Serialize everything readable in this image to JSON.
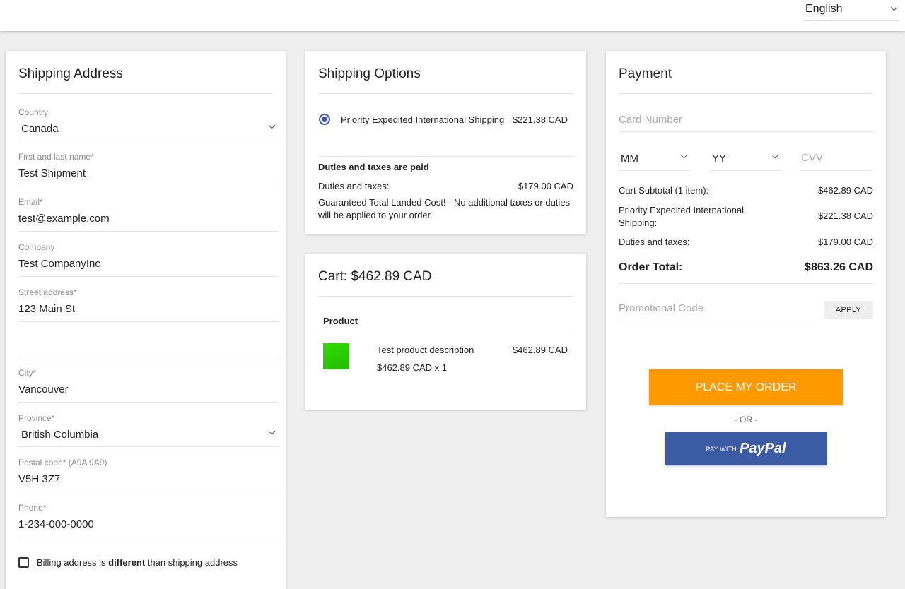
{
  "header": {
    "language": "English"
  },
  "shipping_address": {
    "title": "Shipping Address",
    "fields": [
      {
        "label": "Country",
        "value": "Canada"
      },
      {
        "label": "First and last name*",
        "value": "Test Shipment"
      },
      {
        "label": "Email*",
        "value": "test@example.com"
      },
      {
        "label": "Company",
        "value": "Test CompanyInc"
      },
      {
        "label": "Street address*",
        "value": "123 Main St"
      },
      {
        "label": "City*",
        "value": "Vancouver"
      },
      {
        "label": "Province*",
        "value": "British Columbia"
      },
      {
        "label": "Postal code* (A9A 9A9)",
        "value": "V5H 3Z7"
      },
      {
        "label": "Phone*",
        "value": "1-234-000-0000"
      }
    ],
    "billing_prefix": "Billing address is",
    "billing_bold": "different",
    "billing_suffix": "than shipping address"
  },
  "shipping_options": {
    "title": "Shipping Options",
    "option_name": "Priority Expedited International Shipping",
    "option_price": "$221.38 CAD",
    "duties_heading": "Duties and taxes are paid",
    "duties_label": "Duties and taxes:",
    "duties_value": "$179.00 CAD",
    "guarantee": "Guaranteed Total Landed Cost! - No additional taxes or duties will be applied to your order."
  },
  "cart": {
    "title": "Cart:  $462.89 CAD",
    "col_product": "Product",
    "item_description": "Test product description",
    "item_qty": "$462.89 CAD x 1",
    "item_price": "$462.89 CAD"
  },
  "payment": {
    "title": "Payment",
    "card_placeholder": "Card Number",
    "month": "MM",
    "year": "YY",
    "cvv_placeholder": "CVV",
    "subtotal_label": "Cart Subtotal (1 item):",
    "subtotal_value": "$462.89 CAD",
    "shipping_label": "Priority Expedited International Shipping:",
    "shipping_value": "$221.38 CAD",
    "duties_label": "Duties and taxes:",
    "duties_value": "$179.00 CAD",
    "total_label": "Order Total:",
    "total_value": "$863.26 CAD",
    "promo_placeholder": "Promotional Code",
    "apply_label": "APPLY",
    "place_order_label": "PLACE MY ORDER",
    "or_label": "- OR -",
    "paypal_prefix": "PAY WITH",
    "paypal_brand": "PayPal"
  },
  "colors": {
    "accent": "#fe9900",
    "paypal": "#3b5ba5",
    "radio": "#3f51b5"
  }
}
